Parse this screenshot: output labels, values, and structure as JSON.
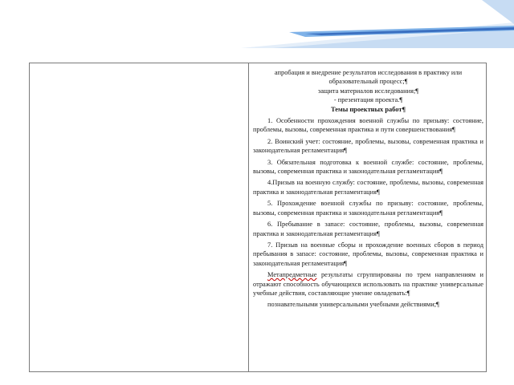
{
  "header": {
    "accent_color": "#2f5fa8",
    "stripe_colors": [
      "#3a6fc0",
      "#7fb2e8",
      "#c7dcf3",
      "#e4eef9"
    ]
  },
  "document": {
    "lines_top": [
      "апробация и внедрение результатов исследования в практику или образовательный процесс;¶",
      "защита материалов исследования;¶",
      "- презентация проекта.¶"
    ],
    "topics_heading": "Темы проектных работ¶",
    "topics": [
      "1. Особенности прохождения военной службы по призыву: состояние, проблемы, вызовы, современная практика и пути совершенствования¶",
      "2. Воинский учет: состояние, проблемы, вызовы, современная практика и законодательная регламентация¶",
      "3. Обязательная подготовка к военной службе: состояние, проблемы, вызовы, современная практика и законодательная регламентация¶",
      "4.Призыв на военную службу: состояние, проблемы, вызовы, современная практика и законодательная регламентация¶",
      "5. Прохождение военной службы по призыву: состояние, проблемы, вызовы, современная практика и законодательная регламентация¶",
      "6. Пребывание в запасе: состояние, проблемы, вызовы, современная практика и законодательная регламентация¶",
      "7. Призыв на военные сборы и прохождение военных сборов в период пребывания в запасе: состояние, проблемы, вызовы, современная практика и законодательная регламентация¶"
    ],
    "meta_term": "Метапредметные",
    "meta_rest": " результаты сгруппированы по трем направлениям и отражают способность обучающихся использовать на практике универсальные учебные действия, составляющие умение овладевать:¶",
    "last_line": "познавательными универсальными учебными действиями;¶"
  }
}
